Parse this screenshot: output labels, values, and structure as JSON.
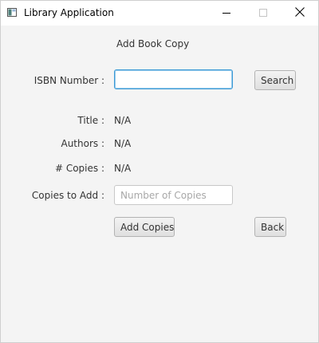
{
  "window": {
    "title": "Library Application",
    "icon": "app-window-icon",
    "controls": {
      "minimize": "minimize-icon",
      "maximize": "maximize-icon",
      "close": "close-icon"
    }
  },
  "form": {
    "heading": "Add Book Copy",
    "isbn": {
      "label": "ISBN Number :",
      "value": "",
      "placeholder": ""
    },
    "search_button": "Search",
    "title": {
      "label": "Title :",
      "value": "N/A"
    },
    "authors": {
      "label": "Authors :",
      "value": "N/A"
    },
    "copies": {
      "label": "# Copies :",
      "value": "N/A"
    },
    "copies_to_add": {
      "label": "Copies to Add :",
      "value": "",
      "placeholder": "Number of Copies"
    },
    "add_button": "Add Copies",
    "back_button": "Back"
  },
  "colors": {
    "background": "#f4f4f4",
    "titlebar": "#ffffff",
    "focus_border": "#3c9ad6",
    "text": "#333333",
    "placeholder": "#a8a8a8"
  }
}
